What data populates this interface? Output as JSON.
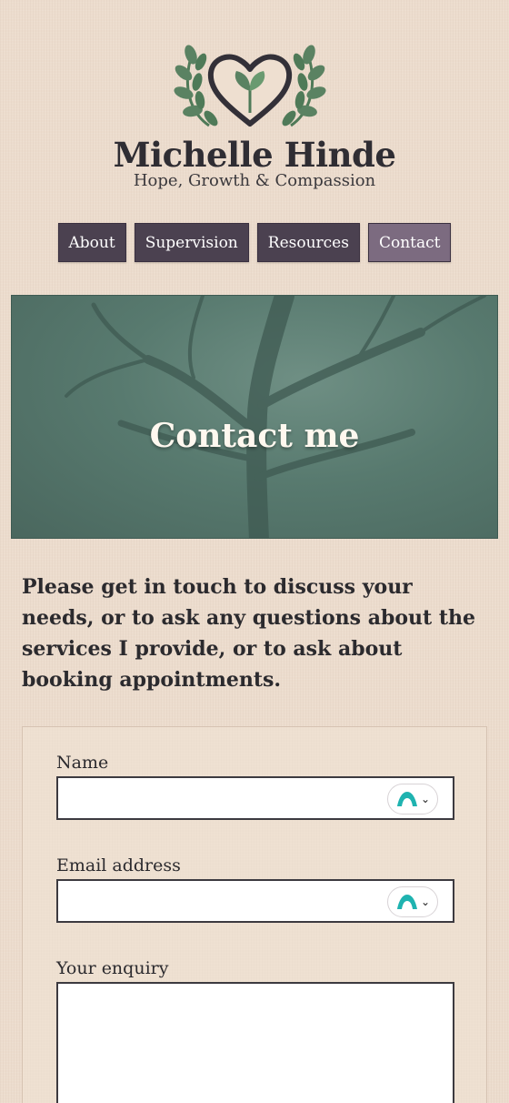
{
  "site": {
    "title": "Michelle Hinde",
    "tagline": "Hope, Growth & Compassion",
    "logo_icon": "heart-sprout-laurel-icon"
  },
  "nav": {
    "items": [
      {
        "label": "About"
      },
      {
        "label": "Supervision"
      },
      {
        "label": "Resources"
      },
      {
        "label": "Contact"
      }
    ],
    "active": "Contact"
  },
  "hero": {
    "title": "Contact me"
  },
  "intro": {
    "text": "Please get in touch to discuss your needs, or to ask any questions about the services I provide, or to ask about booking appointments."
  },
  "form": {
    "name_label": "Name",
    "name_value": "",
    "email_label": "Email address",
    "email_value": "",
    "enquiry_label": "Your enquiry",
    "enquiry_value": "",
    "autofill_icon": "password-manager-icon"
  },
  "colors": {
    "background": "#ecdccd",
    "nav": "#4b4150",
    "nav_active": "#7c6b80",
    "hero": "#587a6f",
    "accent_green": "#4f7a58"
  }
}
